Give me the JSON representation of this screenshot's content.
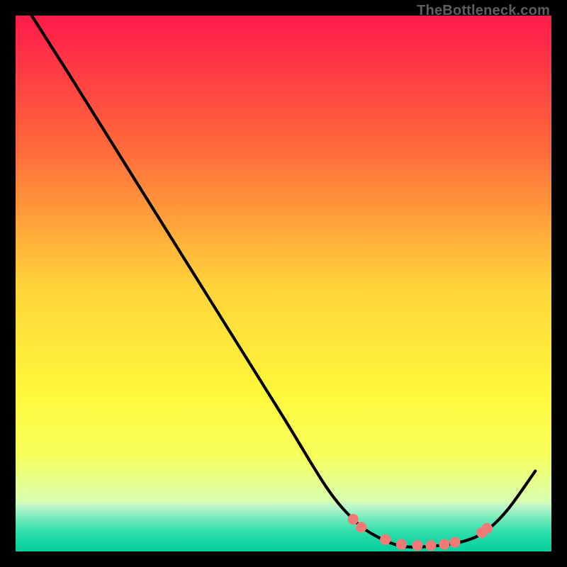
{
  "watermark": "TheBottleneck.com",
  "chart_data": {
    "type": "line",
    "title": "",
    "xlabel": "",
    "ylabel": "",
    "xlim": [
      0,
      100
    ],
    "ylim": [
      0,
      100
    ],
    "grid": false,
    "series": [
      {
        "name": "curve",
        "x": [
          3,
          10,
          20,
          30,
          40,
          50,
          58,
          63,
          67,
          72,
          78,
          84,
          88,
          92,
          97
        ],
        "y": [
          100,
          89,
          73,
          57,
          41,
          25,
          12,
          6,
          3,
          1,
          1,
          2,
          4,
          8,
          15
        ]
      }
    ],
    "markers": {
      "x": [
        63,
        64.5,
        69,
        72,
        75,
        77.5,
        80,
        82,
        87,
        88
      ],
      "y": [
        6,
        4.5,
        2.2,
        1.3,
        1.1,
        1.1,
        1.3,
        1.7,
        3.5,
        4.3
      ]
    },
    "gradient_stops": [
      {
        "pos": 0.0,
        "color": "#ff1a4b"
      },
      {
        "pos": 0.25,
        "color": "#ff6a3a"
      },
      {
        "pos": 0.5,
        "color": "#ffd23a"
      },
      {
        "pos": 0.7,
        "color": "#fff73a"
      },
      {
        "pos": 0.82,
        "color": "#f7ff5a"
      },
      {
        "pos": 0.905,
        "color": "#d8ffb0"
      },
      {
        "pos": 0.918,
        "color": "#b7f5c9"
      },
      {
        "pos": 0.932,
        "color": "#88eec0"
      },
      {
        "pos": 0.946,
        "color": "#5de6b6"
      },
      {
        "pos": 0.96,
        "color": "#39dfae"
      },
      {
        "pos": 0.974,
        "color": "#20d9a7"
      },
      {
        "pos": 0.988,
        "color": "#10d4a2"
      },
      {
        "pos": 1.0,
        "color": "#07d09e"
      }
    ],
    "marker_color": "#f27a76",
    "line_color": "#000000"
  }
}
